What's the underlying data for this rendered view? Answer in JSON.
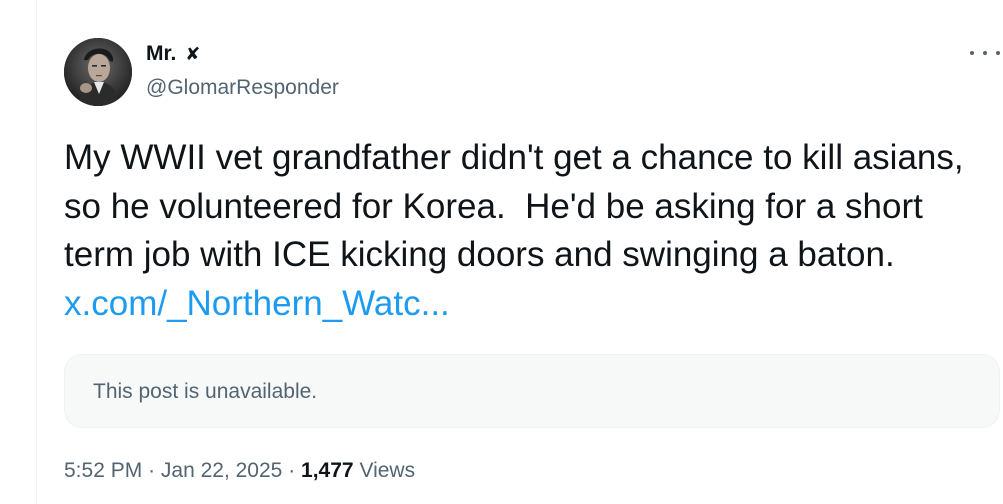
{
  "author": {
    "display_name": "Mr.",
    "badge_glyph": "✘",
    "handle": "@GlomarResponder"
  },
  "tweet": {
    "text_before_link": "My WWII vet grandfather didn't get a chance to kill asians, so he volunteered for Korea.  He'd be asking for a short term job with ICE kicking doors and swinging a baton. ",
    "link_text": "x.com/_Northern_Watc..."
  },
  "quoted_post": {
    "unavailable_text": "This post is unavailable."
  },
  "meta": {
    "time": "5:52 PM",
    "separator": "·",
    "date": "Jan 22, 2025",
    "views_count": "1,477",
    "views_label": "Views"
  },
  "icons": {
    "more": "more-horizontal-icon",
    "avatar": "profile-photo"
  },
  "colors": {
    "text_primary": "#0f1419",
    "text_secondary": "#536471",
    "link": "#1d9bf0",
    "quote_bg": "#f7f9f9",
    "border": "#eff3f4"
  }
}
